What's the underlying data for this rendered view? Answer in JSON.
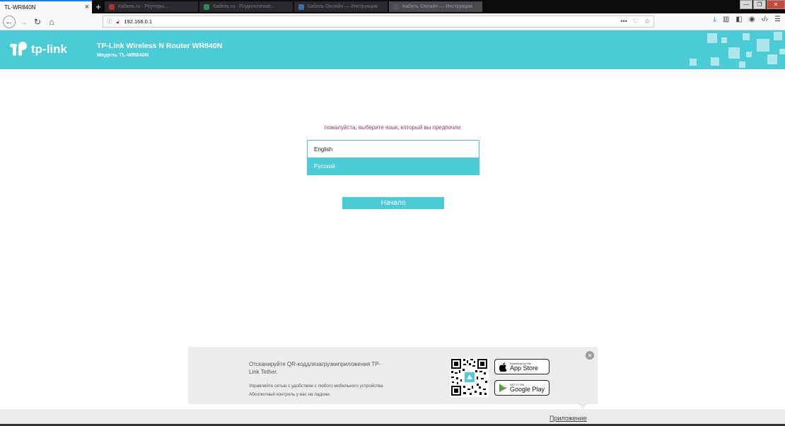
{
  "browser": {
    "active_tab": {
      "title": "TL-WR840N"
    },
    "background_tabs": [
      {
        "title": "Кабель.ru · Роутеры..."
      },
      {
        "title": "Кабель.ru · Подключение..."
      },
      {
        "title": "Кабель Онлайн — Инструкция"
      },
      {
        "title": "Кабель Онлайн — Инструкция"
      }
    ],
    "new_tab_label": "+",
    "url": "192.168.0.1",
    "url_actions": "•••"
  },
  "router": {
    "brand": "tp-link",
    "title": "TP-Link Wireless N Router WR840N",
    "model": "Модель TL-WR840N",
    "accent_color": "#4acbd6"
  },
  "language_select": {
    "prompt": "пожалуйста, выберите язык, который вы предпочли",
    "options": [
      "English",
      "Русский"
    ],
    "selected": "Русский"
  },
  "start_button": {
    "label": "Начало"
  },
  "app_promo": {
    "title": "Отсканируйте QR-коддлязагрузкиприложения TP-Link Tether.",
    "desc_line1": "Управляйте сетью с удобством с любого мобильного устройства.",
    "desc_line2": "Абсолютный контроль у вас на ладони.",
    "app_store": {
      "small": "Download on the",
      "big": "App Store"
    },
    "google_play": {
      "small": "GET IT ON",
      "big": "Google Play"
    }
  },
  "footer": {
    "app_link": "Приложение"
  }
}
